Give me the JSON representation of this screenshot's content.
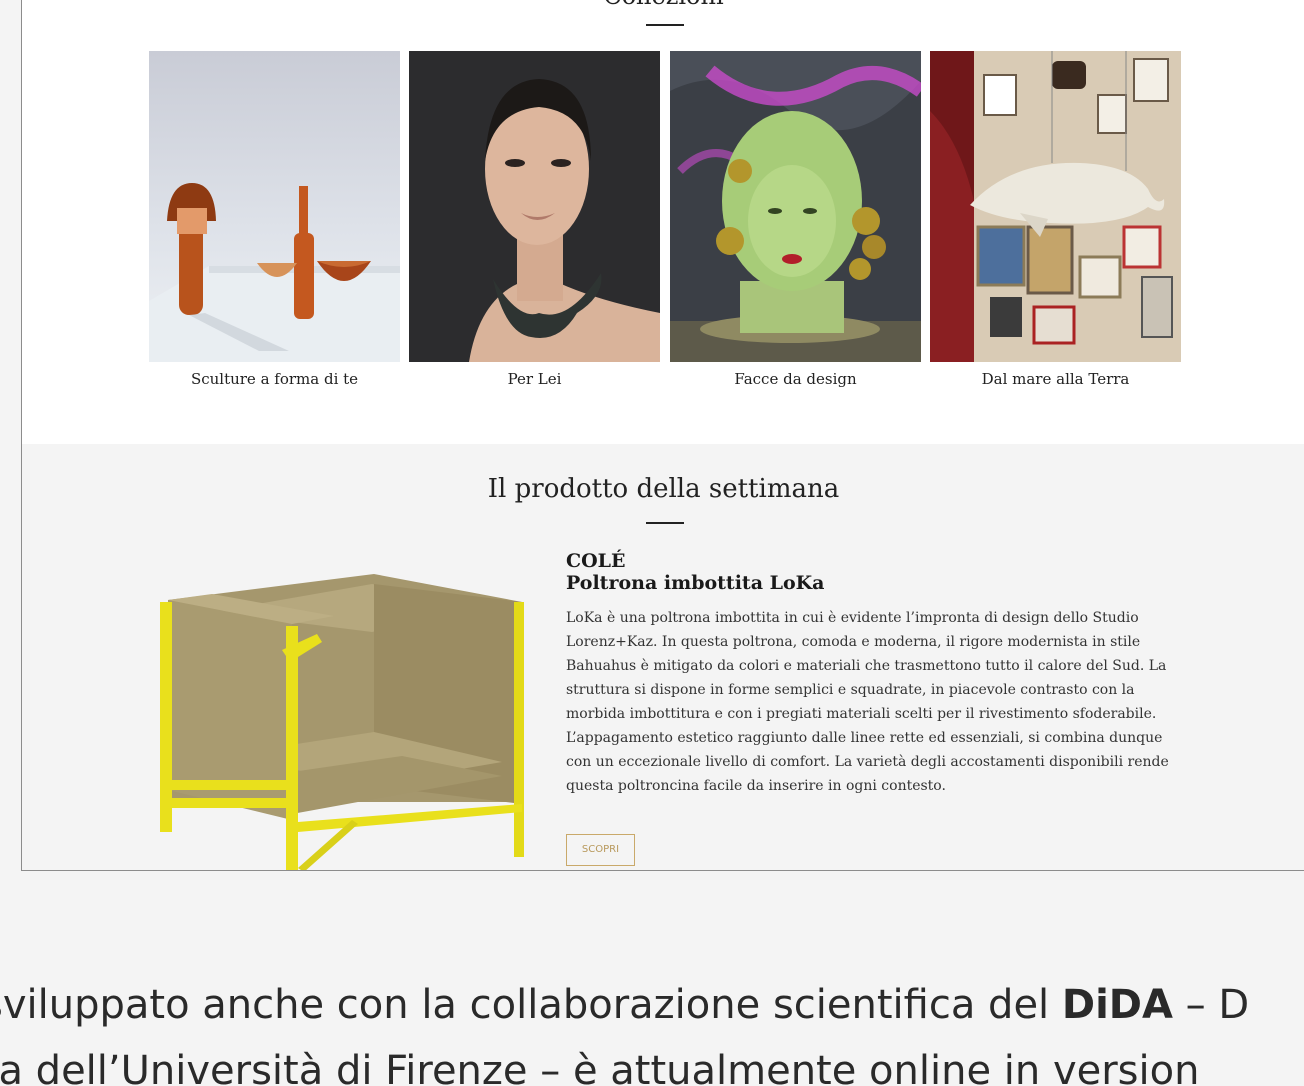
{
  "collections": {
    "title": "Collezioni",
    "items": [
      {
        "label": "Sculture a forma di te"
      },
      {
        "label": "Per Lei"
      },
      {
        "label": "Facce da design"
      },
      {
        "label": "Dal mare alla Terra"
      }
    ]
  },
  "weekly": {
    "title": "Il prodotto della settimana",
    "brand": "COLÉ",
    "product_name": "Poltrona imbottita LoKa",
    "description": "LoKa è una poltrona imbottita in cui è evidente l’impronta di design dello Studio Lorenz+Kaz. In questa poltrona, comoda e moderna, il rigore modernista in stile Bahuahus è mitigato da colori e materiali che trasmettono tutto il calore del Sud. La struttura si dispone in forme semplici e squadrate, in piacevole contrasto con la morbida imbottitura e con i pregiati materiali scelti per il rivestimento sfoderabile. L’appagamento estetico raggiunto dalle linee rette ed essenziali, si combina dunque con un eccezionale livello di comfort. La varietà degli accostamenti disponibili rende questa poltroncina facile da inserire in ogni contesto.",
    "button_label": "SCOPRI"
  },
  "caption": {
    "line1_before": "sviluppato anche con la collaborazione scientifica del ",
    "line1_bold": "DiDA",
    "line1_after": " – D",
    "line2": "ra dell’Università di Firenze – è attualmente online in version"
  },
  "colors": {
    "chair_frame": "#e9e01c",
    "chair_fabric": "#a99a6e",
    "button_border": "#c9a96a",
    "section_bg": "#f4f4f4"
  }
}
